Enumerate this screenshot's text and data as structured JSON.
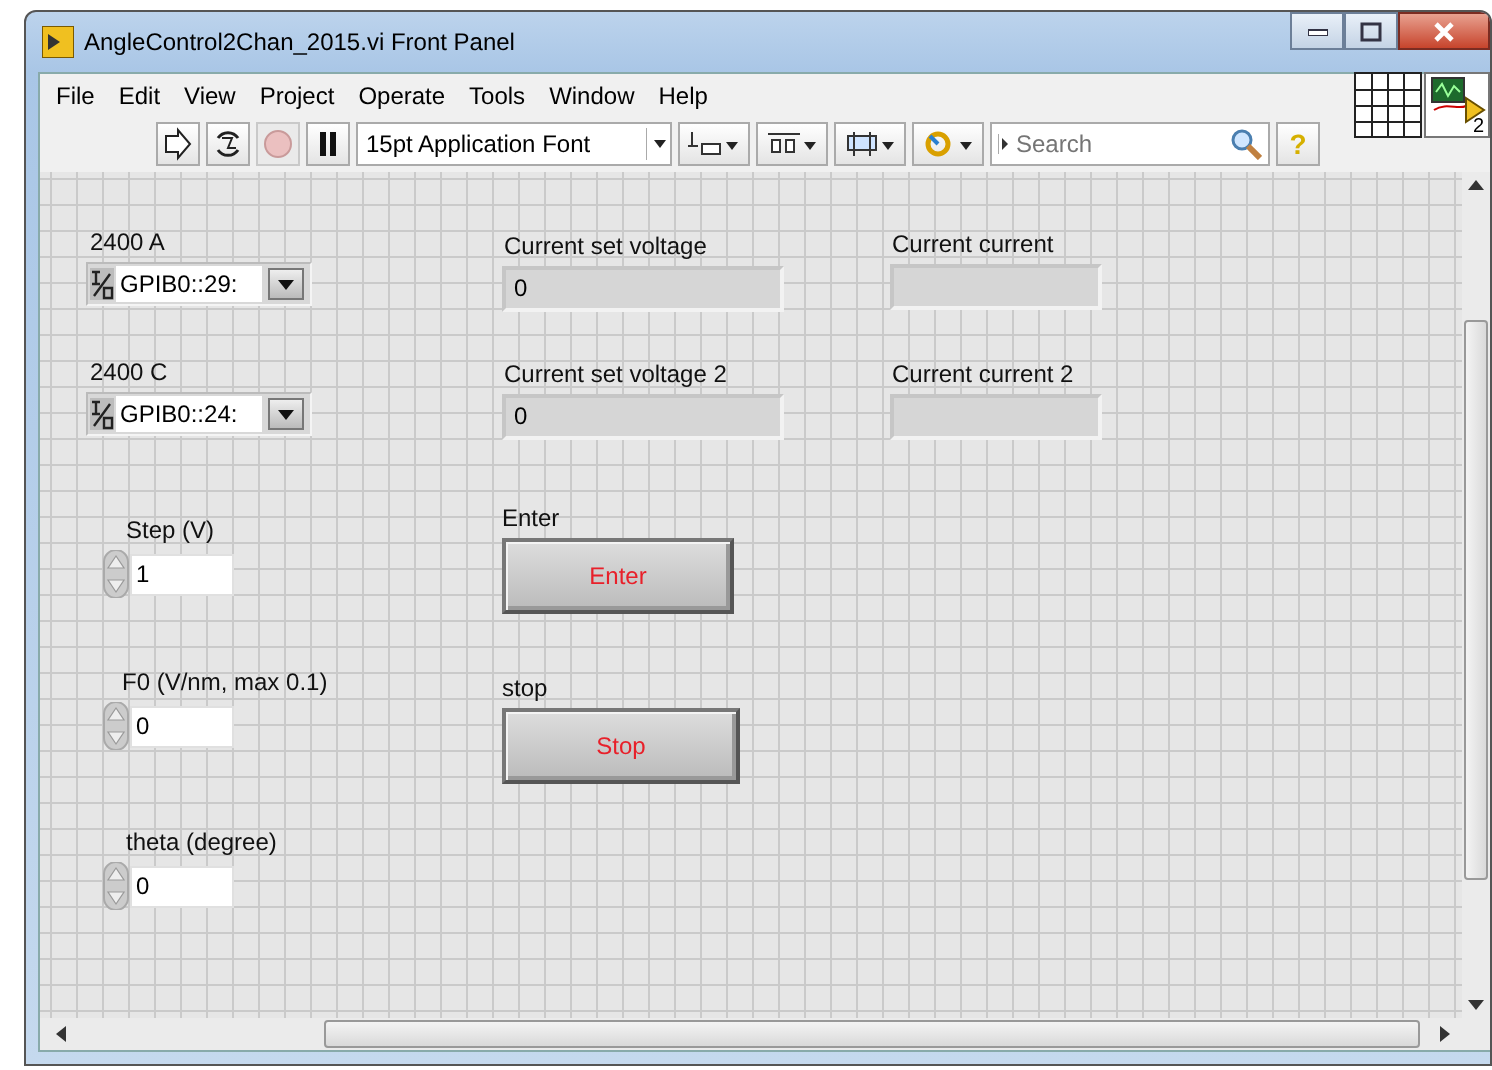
{
  "window": {
    "title": "AngleControl2Chan_2015.vi Front Panel"
  },
  "menu": [
    "File",
    "Edit",
    "View",
    "Project",
    "Operate",
    "Tools",
    "Window",
    "Help"
  ],
  "toolbar": {
    "buttons": [
      {
        "kind": "run",
        "disabled": false
      },
      {
        "kind": "run-continuously",
        "disabled": false
      },
      {
        "kind": "abort",
        "disabled": true
      },
      {
        "kind": "pause",
        "disabled": false
      }
    ],
    "font": "15pt Application Font",
    "search": {
      "placeholder": "Search"
    },
    "help": "?",
    "vi_icon_label": "2"
  },
  "controls": [
    {
      "kind": "visa",
      "label": "2400 A",
      "value": "GPIB0::29:"
    },
    {
      "kind": "visa",
      "label": "2400 C",
      "value": "GPIB0::24:"
    },
    {
      "kind": "indicator",
      "label": "Current set voltage",
      "value": "0"
    },
    {
      "kind": "indicator",
      "label": "Current set voltage 2",
      "value": "0"
    },
    {
      "kind": "indicator",
      "label": "Current current"
    },
    {
      "kind": "indicator",
      "label": "Current current 2"
    },
    {
      "kind": "numeric",
      "label": "Step (V)",
      "value": "1"
    },
    {
      "kind": "numeric",
      "label": "F0 (V/nm, max 0.1)",
      "value": "0"
    },
    {
      "kind": "numeric",
      "label": "theta (degree)",
      "value": "0"
    },
    {
      "kind": "button",
      "label": "Enter",
      "text": "Enter"
    },
    {
      "kind": "button",
      "label": "stop",
      "text": "Stop"
    }
  ]
}
